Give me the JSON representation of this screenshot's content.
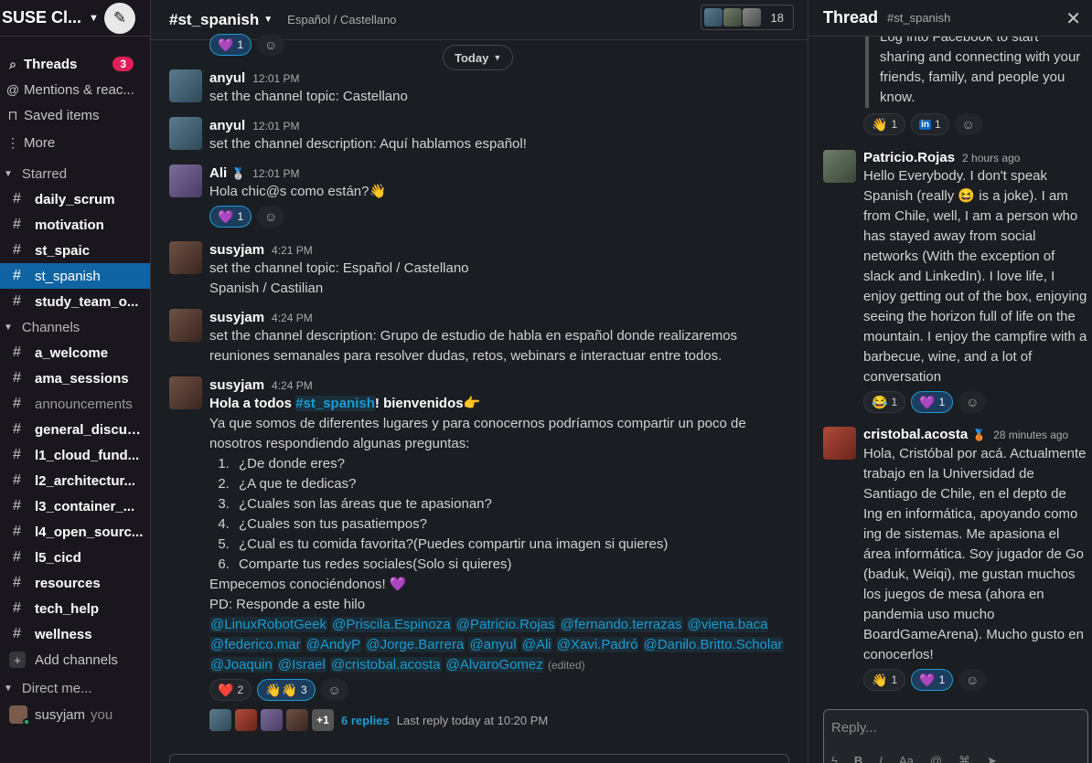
{
  "sidebar": {
    "workspace": "SUSE Cl...",
    "nav": [
      {
        "label": "Threads",
        "badge": "3"
      },
      {
        "label": "Mentions & reac..."
      },
      {
        "label": "Saved items"
      },
      {
        "label": "More"
      }
    ],
    "starred_label": "Starred",
    "starred": [
      "daily_scrum",
      "motivation",
      "st_spaic",
      "st_spanish",
      "study_team_o..."
    ],
    "channels_label": "Channels",
    "channels": [
      "a_welcome",
      "ama_sessions",
      "announcements",
      "general_discus...",
      "l1_cloud_fund...",
      "l2_architectur...",
      "l3_container_...",
      "l4_open_sourc...",
      "l5_cicd",
      "resources",
      "tech_help",
      "wellness"
    ],
    "add_channels": "Add channels",
    "dm_label": "Direct me...",
    "dm_user": "susyjam",
    "dm_you": "you"
  },
  "channel": {
    "name": "#st_spanish",
    "topic": "Español / Castellano",
    "member_count": "18",
    "today_label": "Today"
  },
  "messages": [
    {
      "user": "anyul",
      "time": "12:01 PM",
      "text": "set the channel topic: Castellano"
    },
    {
      "user": "anyul",
      "time": "12:01 PM",
      "text": "set the channel description: Aquí hablamos español!"
    },
    {
      "user": "Ali",
      "time": "12:01 PM",
      "text": "Hola chic@s como están?",
      "emoji": "👋"
    },
    {
      "user": "susyjam",
      "time": "4:21 PM",
      "text": "set the channel topic: Español / Castellano",
      "text2": "Spanish / Castilian"
    },
    {
      "user": "susyjam",
      "time": "4:24 PM",
      "text": "set the channel description: Grupo de estudio de habla en español donde realizaremos reuniones semanales para resolver dudas, retos, webinars  e interactuar entre todos."
    },
    {
      "user": "susyjam",
      "time": "4:24 PM"
    }
  ],
  "post": {
    "greeting_a": "Hola a todos ",
    "channel_link": "#st_spanish",
    "greeting_b": "! bienvenidos",
    "intro": "Ya que somos de diferentes lugares y para conocernos podríamos compartir un poco de nosotros respondiendo algunas preguntas:",
    "questions": [
      "¿De donde eres?",
      "¿A que te dedicas?",
      "¿Cuales son las áreas que te apasionan?",
      "¿Cuales son tus pasatiempos?",
      "¿Cual es tu comida favorita?(Puedes compartir una imagen si quieres)",
      "Comparte tus redes sociales(Solo si quieres)"
    ],
    "closing": "Empecemos conociéndonos! ",
    "pd": "PD: Responde a este hilo",
    "mentions": [
      "@LinuxRobotGeek",
      "@Priscila.Espinoza",
      "@Patricio.Rojas",
      "@fernando.terrazas",
      "@viena.baca",
      "@federico.mar",
      "@AndyP",
      "@Jorge.Barrera",
      "@anyul",
      "@Ali",
      "@Xavi.Padró",
      "@Danilo.Britto.Scholar",
      "@Joaquin",
      "@Israel",
      "@cristobal.acosta",
      "@AlvaroGomez"
    ],
    "edited": "(edited)",
    "react_heart": "2",
    "react_wave": "3",
    "reply_count": "6 replies",
    "last_reply": "Last reply today at 10:20 PM",
    "plus_more": "+1"
  },
  "reactions": {
    "top_heart": "1",
    "ali_heart": "1"
  },
  "thread": {
    "title": "Thread",
    "channel": "#st_spanish",
    "quote": "Log into Facebook to start sharing and connecting with your friends, family, and people you know.",
    "q_react1": "1",
    "q_react2": "1",
    "patricio": {
      "name": "Patricio.Rojas",
      "time": "2 hours ago",
      "text_a": "Hello Everybody. I don't speak Spanish (really ",
      "text_b": " is a joke). I am from Chile, well,  I am a person who has stayed away from social networks (With the exception of slack and LinkedIn). I love life, I enjoy getting out of the box, enjoying seeing the horizon full of life on the mountain. I enjoy the campfire with a barbecue, wine, and a lot of conversation",
      "r1": "1",
      "r2": "1"
    },
    "cristobal": {
      "name": "cristobal.acosta",
      "time": "28 minutes ago",
      "text": "Hola, Cristóbal por acá. Actualmente trabajo en la Universidad de Santiago de Chile, en el depto de Ing en informática, apoyando como ing de sistemas. Me apasiona el área informática. Soy jugador de Go (baduk, Weiqi), me gustan muchos los juegos de mesa (ahora en pandemia uso mucho BoardGameArena). Mucho gusto en conocerlos!",
      "r1": "1",
      "r2": "1"
    },
    "reply_placeholder": "Reply..."
  }
}
